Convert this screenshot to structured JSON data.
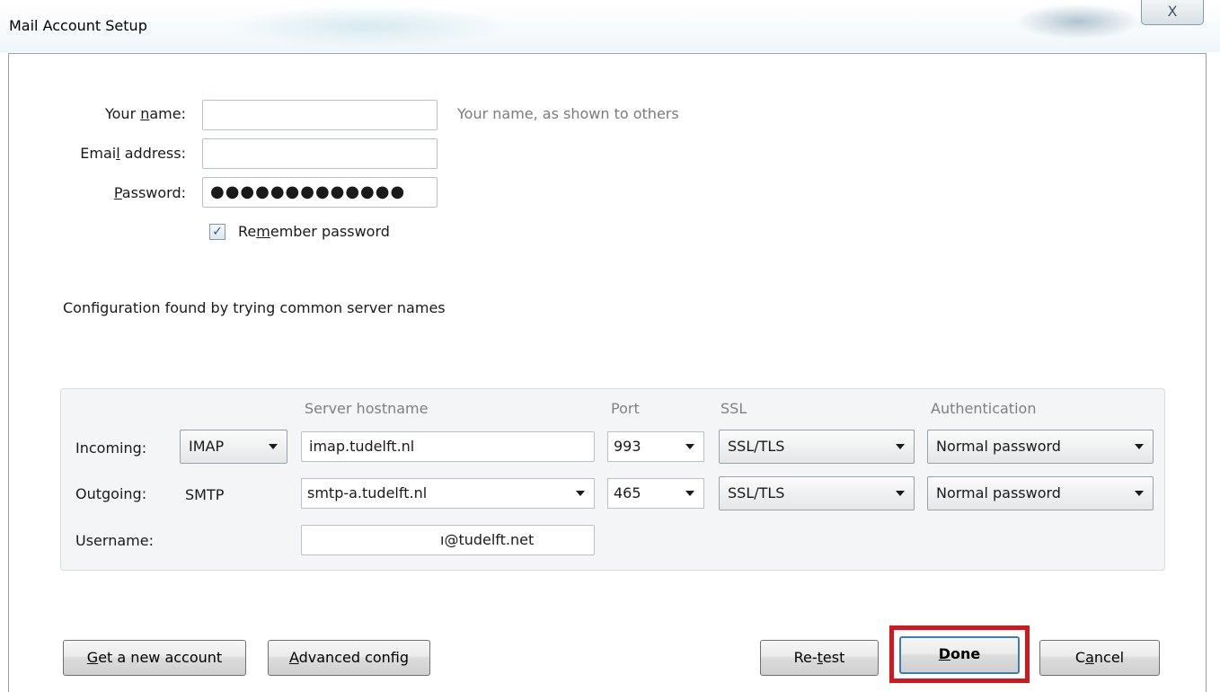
{
  "window": {
    "title": "Mail Account Setup",
    "close_label": "X"
  },
  "form": {
    "name": {
      "label_pre": "Your ",
      "label_ul": "n",
      "label_post": "ame:",
      "value": "",
      "hint": "Your name, as shown to others"
    },
    "email": {
      "label_pre": "Emai",
      "label_ul": "l",
      "label_post": " address:",
      "value": ""
    },
    "password": {
      "label_pre": "",
      "label_ul": "P",
      "label_post": "assword:",
      "value": "●●●●●●●●●●●●●"
    },
    "remember": {
      "checked": true,
      "label_pre": "Re",
      "label_ul": "m",
      "label_post": "ember password",
      "check_glyph": "✓"
    }
  },
  "status_text": "Configuration found by trying common server names",
  "server": {
    "headers": {
      "hostname": "Server hostname",
      "port": "Port",
      "ssl": "SSL",
      "auth": "Authentication"
    },
    "incoming": {
      "label": "Incoming:",
      "protocol": "IMAP",
      "hostname": "imap.tudelft.nl",
      "port": "993",
      "ssl": "SSL/TLS",
      "auth": "Normal password"
    },
    "outgoing": {
      "label": "Outgoing:",
      "protocol": "SMTP",
      "hostname": "smtp-a.tudelft.nl",
      "port": "465",
      "ssl": "SSL/TLS",
      "auth": "Normal password"
    },
    "username": {
      "label": "Username:",
      "value": "ı@tudelft.net"
    }
  },
  "buttons": {
    "get_account": {
      "ul": "G",
      "rest": "et a new account"
    },
    "advanced": {
      "ul": "A",
      "rest": "dvanced config"
    },
    "retest": {
      "pre": "Re-",
      "ul": "t",
      "post": "est"
    },
    "done": {
      "ul": "D",
      "rest": "one"
    },
    "cancel": {
      "pre": "C",
      "ul": "a",
      "post": "ncel"
    }
  },
  "colors": {
    "highlight": "#d0191f",
    "default_button_border": "#3c7fb1",
    "checkbox_check": "#2a55a5"
  }
}
